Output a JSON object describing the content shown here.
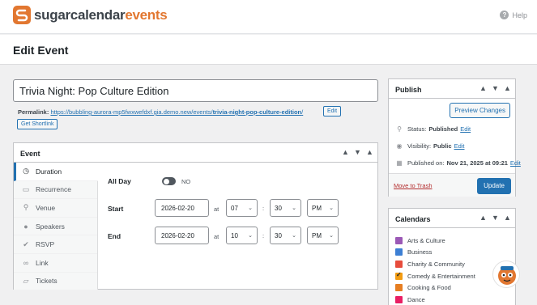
{
  "brand": {
    "name_a": "sugarcalendar",
    "name_b": "events",
    "help_label": "Help"
  },
  "page": {
    "title": "Edit Event"
  },
  "event": {
    "title_value": "Trivia Night: Pop Culture Edition",
    "permalink_label": "Permalink:",
    "permalink_base": "https://bubbling-aurora-mp5fwxwefdxf.gia.demo.new/events/",
    "permalink_slug": "trivia-night-pop-culture-edition",
    "permalink_tail": "/",
    "edit_label": "Edit",
    "shortlink_label": "Get Shortlink"
  },
  "event_box": {
    "title": "Event",
    "tabs": [
      {
        "label": "Duration",
        "icon": "clock-icon"
      },
      {
        "label": "Recurrence",
        "icon": "recurrence-icon"
      },
      {
        "label": "Venue",
        "icon": "map-pin-icon"
      },
      {
        "label": "Speakers",
        "icon": "person-icon"
      },
      {
        "label": "RSVP",
        "icon": "check-badge-icon"
      },
      {
        "label": "Link",
        "icon": "link-icon"
      },
      {
        "label": "Tickets",
        "icon": "ticket-icon"
      }
    ],
    "all_day_label": "All Day",
    "all_day_value": "NO",
    "start_label": "Start",
    "end_label": "End",
    "at": "at",
    "colon": ":",
    "start": {
      "date": "2026-02-20",
      "hour": "07",
      "minute": "30",
      "ampm": "PM"
    },
    "end": {
      "date": "2026-02-20",
      "hour": "10",
      "minute": "30",
      "ampm": "PM"
    }
  },
  "publish": {
    "title": "Publish",
    "preview_label": "Preview Changes",
    "status_label": "Status:",
    "status_value": "Published",
    "visibility_label": "Visibility:",
    "visibility_value": "Public",
    "published_label": "Published on:",
    "published_value": "Nov 21, 2025 at 09:21",
    "edit_label": "Edit",
    "trash_label": "Move to Trash",
    "update_label": "Update"
  },
  "calendars": {
    "title": "Calendars",
    "items": [
      {
        "label": "Arts & Culture",
        "color": "#9b59b6",
        "checked": false
      },
      {
        "label": "Business",
        "color": "#3d7fd4",
        "checked": false
      },
      {
        "label": "Charity & Community",
        "color": "#e74c3c",
        "checked": false
      },
      {
        "label": "Comedy & Entertainment",
        "color": "#f39c12",
        "checked": true
      },
      {
        "label": "Cooking & Food",
        "color": "#e67e22",
        "checked": false
      },
      {
        "label": "Dance",
        "color": "#e91e63",
        "checked": false
      }
    ]
  },
  "colors": {
    "accent": "#2271b1",
    "brand": "#e27730",
    "danger": "#b32d2e"
  }
}
